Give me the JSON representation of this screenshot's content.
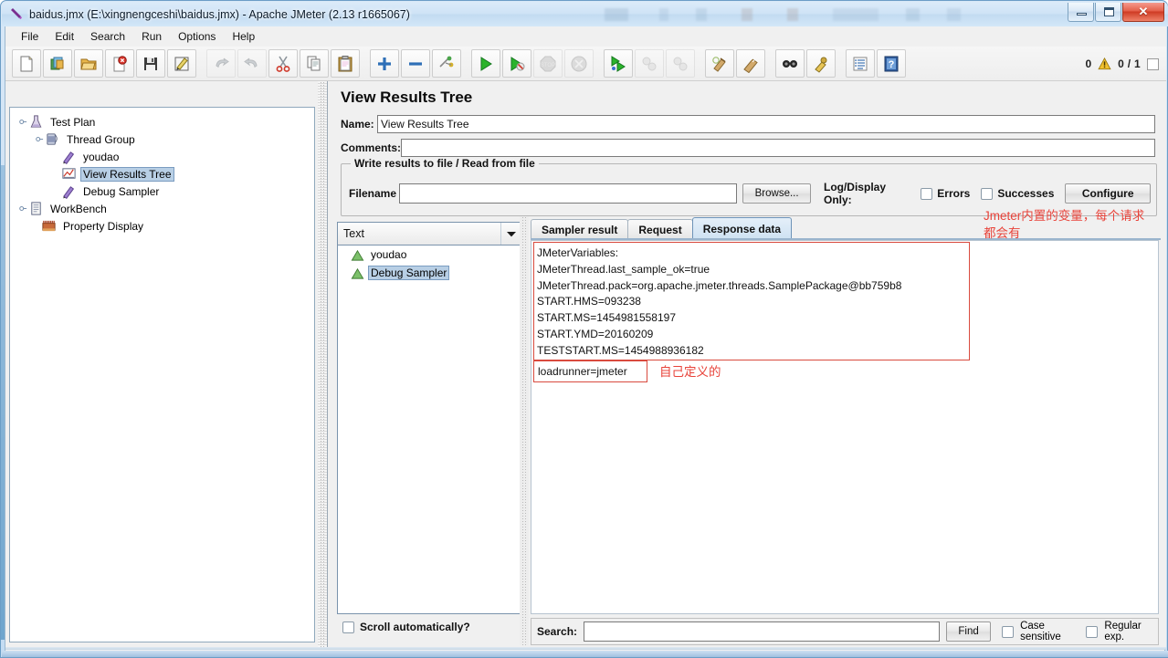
{
  "window": {
    "title": "baidus.jmx (E:\\xingnengceshi\\baidus.jmx) - Apache JMeter (2.13 r1665067)",
    "minimize_label": "–",
    "maximize_label": "□",
    "close_label": "✕"
  },
  "menu": {
    "items": [
      "File",
      "Edit",
      "Search",
      "Run",
      "Options",
      "Help"
    ]
  },
  "toolbar": {
    "buttons": [
      {
        "name": "new-icon",
        "enabled": true
      },
      {
        "name": "templates-icon",
        "enabled": true
      },
      {
        "name": "open-icon",
        "enabled": true
      },
      {
        "name": "close-icon",
        "enabled": true
      },
      {
        "name": "save-icon",
        "enabled": true
      },
      {
        "name": "save-as-icon",
        "enabled": true
      },
      {
        "name": "undo-icon",
        "enabled": false
      },
      {
        "name": "redo-icon",
        "enabled": false
      },
      {
        "name": "cut-icon",
        "enabled": true
      },
      {
        "name": "copy-icon",
        "enabled": true
      },
      {
        "name": "paste-icon",
        "enabled": true
      },
      {
        "name": "expand-all-icon",
        "enabled": true
      },
      {
        "name": "collapse-all-icon",
        "enabled": true
      },
      {
        "name": "toggle-icon",
        "enabled": true
      },
      {
        "name": "start-icon",
        "enabled": true
      },
      {
        "name": "start-no-timers-icon",
        "enabled": true
      },
      {
        "name": "stop-icon",
        "enabled": false
      },
      {
        "name": "shutdown-icon",
        "enabled": false
      },
      {
        "name": "remote-start-all-icon",
        "enabled": true
      },
      {
        "name": "remote-stop-all-icon",
        "enabled": false
      },
      {
        "name": "remote-shutdown-all-icon",
        "enabled": false
      },
      {
        "name": "clear-icon",
        "enabled": true
      },
      {
        "name": "clear-all-icon",
        "enabled": true
      },
      {
        "name": "search-icon",
        "enabled": true
      },
      {
        "name": "search-reset-icon",
        "enabled": true
      },
      {
        "name": "function-helper-icon",
        "enabled": true
      },
      {
        "name": "help-icon",
        "enabled": true
      }
    ],
    "warning_count": "0",
    "thread_count": "0 / 1"
  },
  "tree": {
    "nodes": [
      {
        "label": "Test Plan",
        "icon": "test-plan-icon",
        "depth": 0,
        "selected": false,
        "handle": true
      },
      {
        "label": "Thread Group",
        "icon": "thread-group-icon",
        "depth": 1,
        "selected": false,
        "handle": true
      },
      {
        "label": "youdao",
        "icon": "sampler-icon",
        "depth": 2,
        "selected": false,
        "handle": false
      },
      {
        "label": "View Results Tree",
        "icon": "view-results-tree-icon",
        "depth": 2,
        "selected": true,
        "handle": false
      },
      {
        "label": "Debug Sampler",
        "icon": "sampler-icon",
        "depth": 2,
        "selected": false,
        "handle": false
      },
      {
        "label": "WorkBench",
        "icon": "workbench-icon",
        "depth": 0,
        "selected": false,
        "handle": true
      },
      {
        "label": "Property Display",
        "icon": "property-display-icon",
        "depth": 1,
        "selected": false,
        "handle": false
      }
    ]
  },
  "panel": {
    "title": "View Results Tree",
    "name_label": "Name:",
    "name_value": "View Results Tree",
    "comments_label": "Comments:",
    "comments_value": "",
    "file_group_title": "Write results to file / Read from file",
    "filename_label": "Filename",
    "filename_value": "",
    "browse_label": "Browse...",
    "log_display_label": "Log/Display Only:",
    "errors_label": "Errors",
    "successes_label": "Successes",
    "configure_label": "Configure",
    "errors_checked": false,
    "successes_checked": false
  },
  "results": {
    "render_selector_value": "Text",
    "render_options": [
      "Text"
    ],
    "items": [
      {
        "label": "youdao",
        "icon": "result-success-icon",
        "selected": false
      },
      {
        "label": "Debug Sampler",
        "icon": "result-success-icon",
        "selected": true
      }
    ],
    "scroll_automatically_label": "Scroll automatically?",
    "scroll_automatically_checked": false
  },
  "tabs": [
    {
      "label": "Sampler result",
      "active": false
    },
    {
      "label": "Request",
      "active": false
    },
    {
      "label": "Response data",
      "active": true
    }
  ],
  "response": {
    "lines": [
      "JMeterVariables:",
      "JMeterThread.last_sample_ok=true",
      "JMeterThread.pack=org.apache.jmeter.threads.SamplePackage@bb759b8",
      "START.HMS=093238",
      "START.MS=1454981558197",
      "START.YMD=20160209",
      "TESTSTART.MS=1454988936182"
    ],
    "custom_variable_line": "loadrunner=jmeter"
  },
  "annotations": [
    {
      "name": "builtin-variables-note",
      "text": "Jmeter内置的变量，每个请求",
      "text2": "都会有",
      "color": "#e8433a"
    },
    {
      "name": "custom-variable-note",
      "text": "自己定义的",
      "color": "#e8433a"
    }
  ],
  "search": {
    "label": "Search:",
    "value": "",
    "find_label": "Find",
    "case_sensitive_label": "Case sensitive",
    "regular_exp_label": "Regular exp.",
    "case_sensitive_checked": false,
    "regular_exp_checked": false
  },
  "colors": {
    "annotation_red": "#e8433a",
    "selection_blue": "#b8cfe5",
    "active_tab": "#cfe2f2"
  }
}
